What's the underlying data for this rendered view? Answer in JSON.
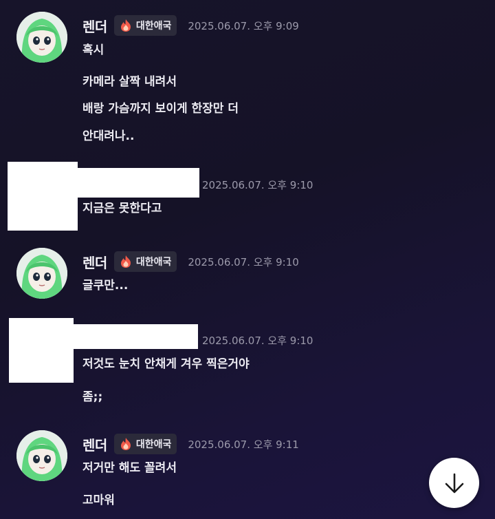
{
  "user": {
    "name": "렌더",
    "badge": "대한애국"
  },
  "messages": [
    {
      "time": "2025.06.07. 오후 9:09",
      "lines": [
        "혹시",
        "카메라 살짝 내려서",
        "배랑 가슴까지 보이게 한장만 더",
        "안대려나.."
      ]
    },
    {
      "time": "2025.06.07. 오후 9:10",
      "lines": [
        "지금은 못한다고"
      ]
    },
    {
      "time": "2025.06.07. 오후 9:10",
      "lines": [
        "글쿠만..."
      ]
    },
    {
      "time": "2025.06.07. 오후 9:10",
      "lines": [
        "저것도 눈치 안채게 겨우 찍은거야",
        "좀;;"
      ]
    },
    {
      "time": "2025.06.07. 오후 9:11",
      "lines": [
        "저거만 해도 꼴려서",
        "고마워"
      ]
    }
  ],
  "icons": {
    "badge": "flame-icon",
    "scroll": "arrow-down-icon"
  },
  "colors": {
    "background": "#17142a",
    "badge_bg": "#2b2a3a",
    "timestamp": "#9c9aab"
  }
}
